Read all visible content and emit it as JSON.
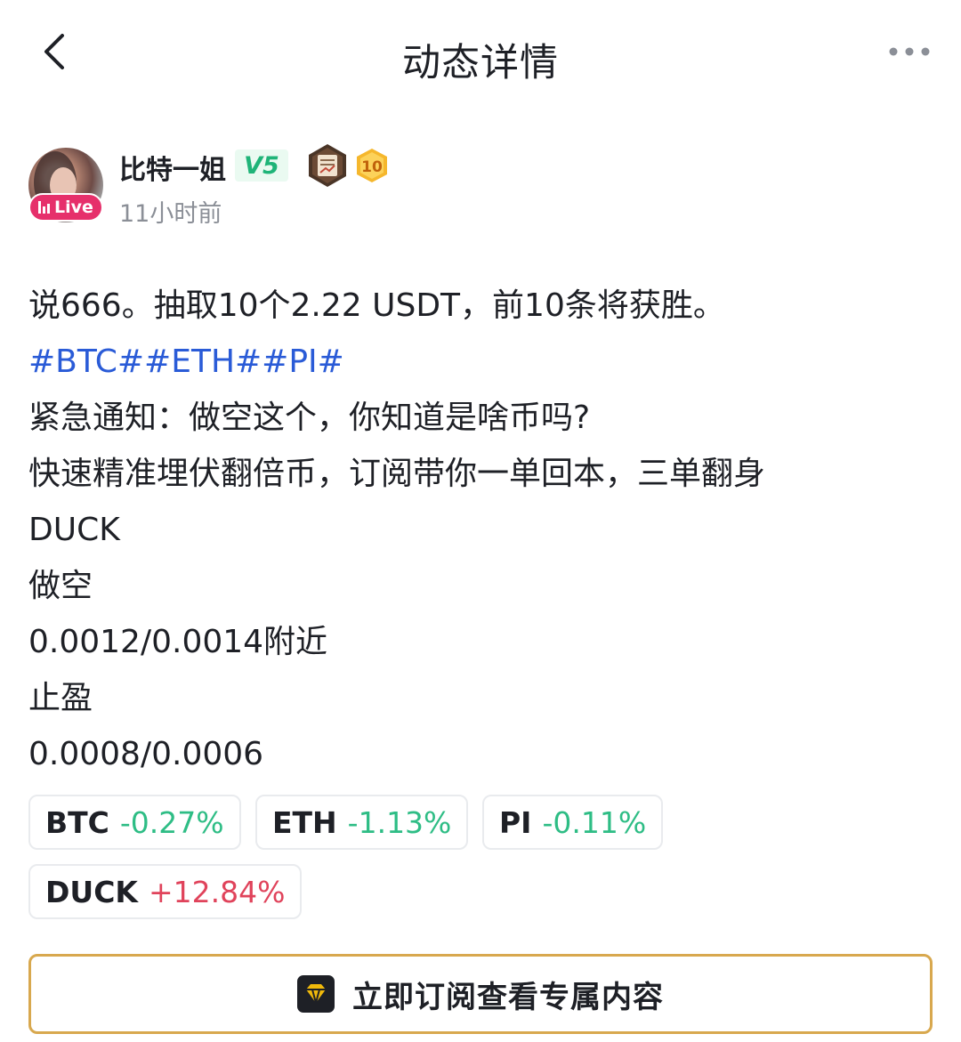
{
  "header": {
    "title": "动态详情",
    "back_icon": "chevron-left-icon",
    "more_icon": "more-horizontal-icon"
  },
  "author": {
    "name": "比特一姐",
    "vip_level": "V5",
    "live_label": "Live",
    "level_badge": "10",
    "time": "11小时前",
    "medal_icon": "scroll-medal-icon"
  },
  "post": {
    "lines": [
      "说666。抽取10个2.22 USDT，前10条将获胜。",
      "#BTC##ETH##PI#",
      "紧急通知：做空这个，你知道是啥币吗?",
      "快速精准埋伏翻倍币，订阅带你一单回本，三单翻身",
      "DUCK",
      "做空",
      "0.0012/0.0014附近",
      "止盈",
      "0.0008/0.0006"
    ]
  },
  "coins": [
    {
      "symbol": "BTC",
      "change": "-0.27%",
      "direction": "down"
    },
    {
      "symbol": "ETH",
      "change": "-1.13%",
      "direction": "down"
    },
    {
      "symbol": "PI",
      "change": "-0.11%",
      "direction": "down"
    },
    {
      "symbol": "DUCK",
      "change": "+12.84%",
      "direction": "up"
    }
  ],
  "subscribe": {
    "label": "立即订阅查看专属内容",
    "icon": "diamond-icon"
  },
  "colors": {
    "tag_blue": "#2a5bd7",
    "down_green": "#2ebd85",
    "up_red": "#e0435b",
    "vip_green": "#1fb478",
    "live_pink": "#e6306b",
    "gold_border": "#d8a84e"
  }
}
